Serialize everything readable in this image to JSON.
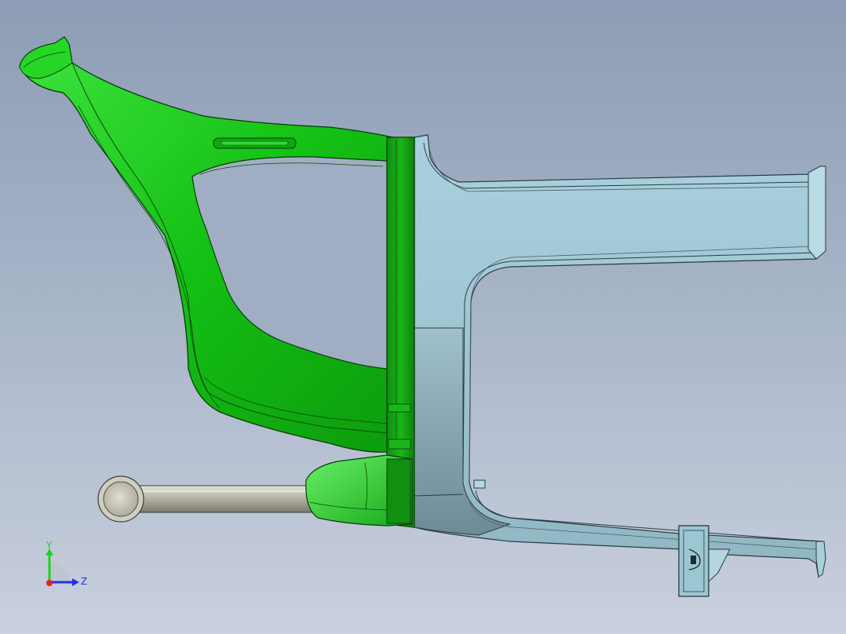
{
  "viewport": {
    "background_top": "#8c9db5",
    "background_bottom": "#c9d0de"
  },
  "model": {
    "parts": [
      {
        "name": "green-frame-part",
        "color": "#19c419"
      },
      {
        "name": "blue-frame-part",
        "color": "#a9cedb"
      },
      {
        "name": "dark-green-bracket",
        "color": "#1aa31a"
      },
      {
        "name": "steel-axle-rod",
        "color": "#b9b7a8"
      },
      {
        "name": "end-mount-bracket",
        "color": "#9fc8d4"
      }
    ],
    "edge_color": "#1a2a1a"
  },
  "triad": {
    "y_label": "Y",
    "z_label": "Z",
    "y_color": "#1fcf1f",
    "z_color": "#2233dd",
    "x_color": "#dd2222"
  }
}
